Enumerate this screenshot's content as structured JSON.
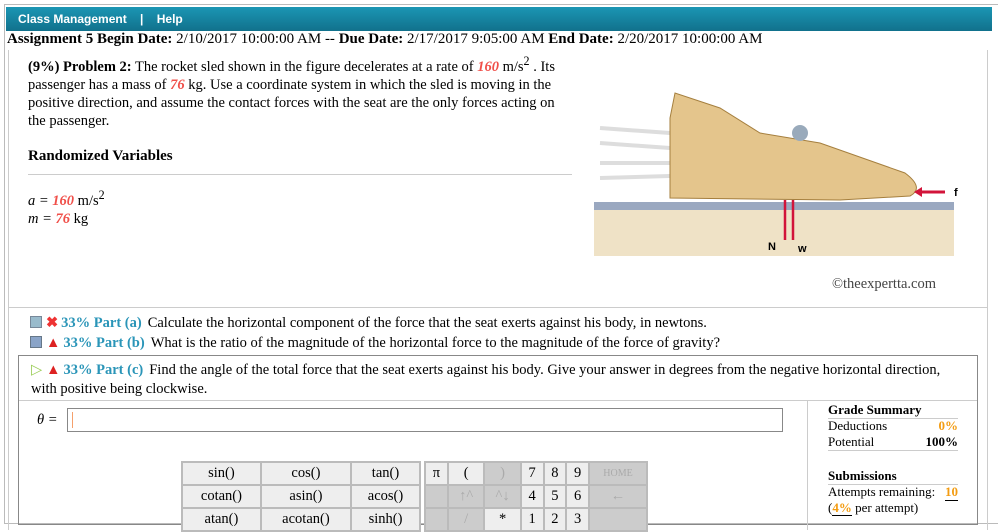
{
  "nav": {
    "class_management": "Class Management",
    "sep": "|",
    "help": "Help"
  },
  "assignment": {
    "name": "Assignment 5",
    "begin_label": "Begin Date:",
    "begin": "2/10/2017 10:00:00 AM",
    "dash": "--",
    "due_label": "Due Date:",
    "due": "2/17/2017 9:05:00 AM",
    "end_label": "End Date:",
    "end": "2/20/2017 10:00:00 AM"
  },
  "problem": {
    "head": "(9%) Problem 2:",
    "t1": "The rocket sled shown in the figure decelerates at a rate of",
    "a": "160",
    "t2": "m/s",
    "t2sup": "2",
    "t3": ". Its passenger has a mass of",
    "m": "76",
    "t4": "kg. Use a coordinate system in which the sled is moving in the positive direction, and assume the contact forces with the seat are the only forces acting on the passenger."
  },
  "randomized": {
    "title": "Randomized Variables",
    "a_label": "a =",
    "a_val": "160",
    "a_unit": "m/s",
    "a_sup": "2",
    "m_label": "m =",
    "m_val": "76",
    "m_unit": "kg"
  },
  "figure": {
    "f": "f",
    "n": "N",
    "w": "w",
    "copyright": "©theexpertta.com"
  },
  "parts": [
    {
      "pct": "33% Part (a)",
      "text": "Calculate the horizontal component of the force that the seat exerts against his body, in newtons."
    },
    {
      "pct": "33% Part (b)",
      "text": "What is the ratio of the magnitude of the horizontal force to the magnitude of the force of gravity?"
    },
    {
      "pct": "33% Part (c)",
      "text": "Find the angle of the total force that the seat exerts against his body. Give your answer in degrees from the negative horizontal direction, with positive being clockwise."
    }
  ],
  "answer": {
    "label": "θ =",
    "value": ""
  },
  "grade": {
    "title": "Grade Summary",
    "deductions_label": "Deductions",
    "deductions": "0%",
    "potential_label": "Potential",
    "potential": "100%",
    "submissions": "Submissions",
    "attempts_label": "Attempts remaining:",
    "attempts": "10",
    "per_open": "(",
    "per": "4%",
    "per_close": "per attempt)"
  },
  "keypad": {
    "funcs": [
      [
        "sin()",
        "cos()",
        "tan()"
      ],
      [
        "cotan()",
        "asin()",
        "acos()"
      ],
      [
        "atan()",
        "acotan()",
        "sinh()"
      ]
    ],
    "keys": [
      [
        "π",
        "(",
        ")",
        "7",
        "8",
        "9",
        "HOME"
      ],
      [
        "",
        "↑^",
        "^↓",
        "4",
        "5",
        "6",
        "←"
      ],
      [
        "",
        "/",
        "*",
        "1",
        "2",
        "3",
        ""
      ]
    ]
  }
}
